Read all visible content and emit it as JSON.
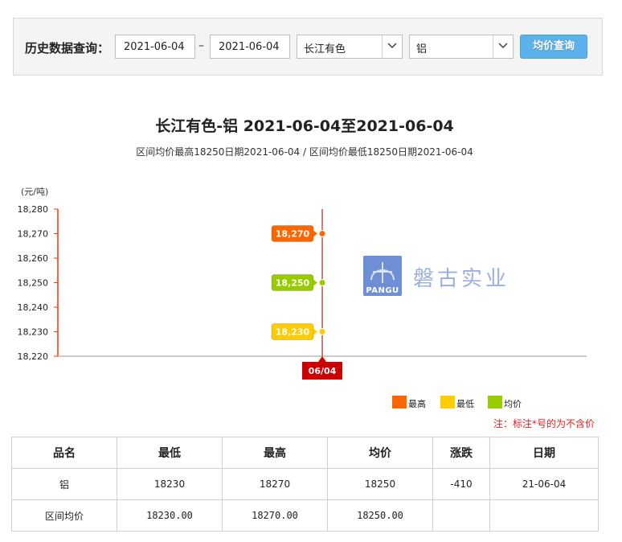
{
  "query": {
    "label": "历史数据查询：",
    "start_date": "2021-06-04",
    "end_date": "2021-06-04",
    "separator": "–",
    "market": "长江有色",
    "metal": "铝",
    "button_label": "均价查询"
  },
  "chart_data": {
    "type": "scatter",
    "title": "长江有色-铝 2021-06-04至2021-06-04",
    "subtitle": "区间均价最高18250日期2021-06-04 / 区间均价最低18250日期2021-06-04",
    "ylabel": "(元/吨)",
    "ylim": [
      18220,
      18280
    ],
    "yticks": [
      "18,280",
      "18,270",
      "18,260",
      "18,250",
      "18,240",
      "18,230",
      "18,220"
    ],
    "ytick_values": [
      18280,
      18270,
      18260,
      18250,
      18240,
      18230,
      18220
    ],
    "categories": [
      "06/04"
    ],
    "series": [
      {
        "name": "最高",
        "values": [
          18270
        ],
        "label": "18,270",
        "color": "#ff6600"
      },
      {
        "name": "最低",
        "values": [
          18230
        ],
        "label": "18,230",
        "color": "#ffcc00"
      },
      {
        "name": "均价",
        "values": [
          18250
        ],
        "label": "18,250",
        "color": "#99cc00"
      }
    ],
    "legend_position": "bottom-right",
    "axis_color": "#ff3300",
    "crosshair_color": "#8b0000",
    "category_badge_color": "#cc0000"
  },
  "watermark": {
    "logo_text": "PANGU",
    "brand": "磐古实业"
  },
  "note": "注：标注*号的为不含价",
  "table": {
    "headers": [
      "品名",
      "最低",
      "最高",
      "均价",
      "涨跌",
      "日期"
    ],
    "rows": [
      [
        "铝",
        "18230",
        "18270",
        "18250",
        "-410",
        "21-06-04"
      ],
      [
        "区间均价",
        "18230.00",
        "18270.00",
        "18250.00",
        "",
        ""
      ]
    ]
  }
}
